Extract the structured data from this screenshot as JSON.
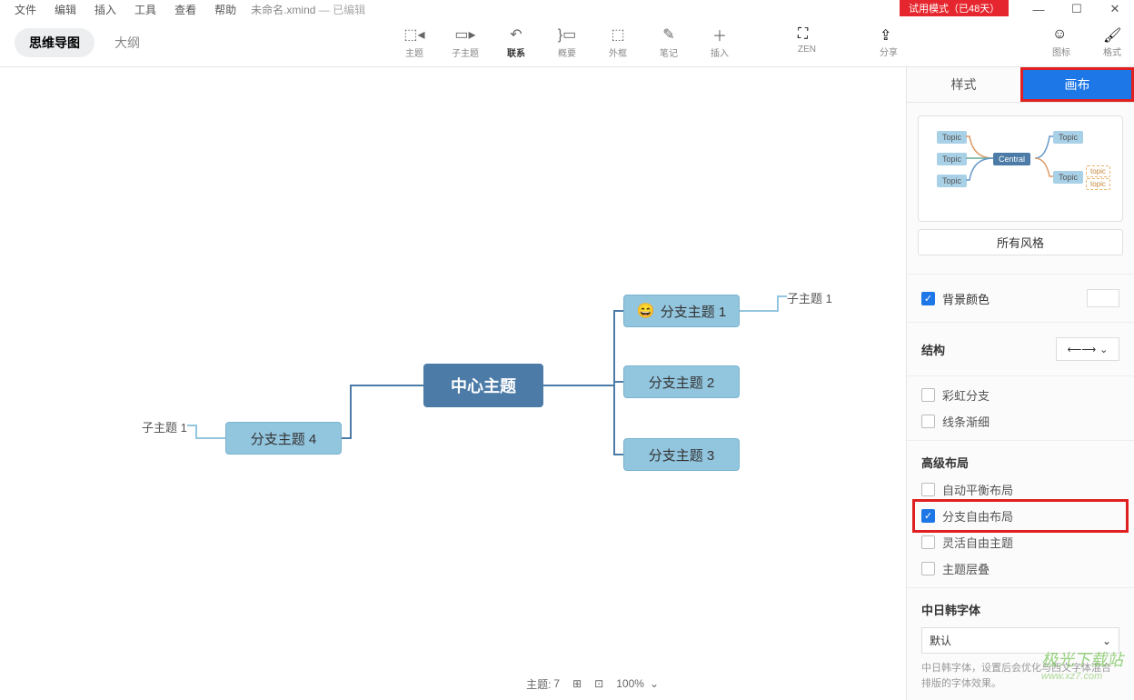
{
  "menu": {
    "file": "文件",
    "edit": "编辑",
    "insert": "插入",
    "tools": "工具",
    "view": "查看",
    "help": "帮助"
  },
  "doc": {
    "name": "未命名.xmind",
    "status": "— 已编辑"
  },
  "trial": "试用模式（已48天）",
  "viewToggle": {
    "mindmap": "思维导图",
    "outline": "大纲"
  },
  "tools": {
    "topic": "主题",
    "subtopic": "子主题",
    "relation": "联系",
    "summary": "概要",
    "boundary": "外框",
    "note": "笔记",
    "insert": "插入",
    "zen": "ZEN",
    "share": "分享",
    "icon": "图标",
    "format": "格式"
  },
  "mindmap": {
    "central": "中心主题",
    "b1": "分支主题 1",
    "b2": "分支主题 2",
    "b3": "分支主题 3",
    "b4": "分支主题 4",
    "sub1r": "子主题 1",
    "sub1l": "子主题 1"
  },
  "panel": {
    "tab_style": "样式",
    "tab_canvas": "画布",
    "all_styles": "所有风格",
    "bg_color": "背景颜色",
    "structure": "结构",
    "rainbow": "彩虹分支",
    "thinline": "线条渐细",
    "adv_layout": "高级布局",
    "auto_balance": "自动平衡布局",
    "free_branch": "分支自由布局",
    "free_topic": "灵活自由主题",
    "topic_overlap": "主题层叠",
    "cjk_font": "中日韩字体",
    "font_default": "默认",
    "font_desc": "中日韩字体，设置后会优化与西文字体混合排版的字体效果。",
    "preview_central": "Central",
    "preview_topic": "Topic",
    "preview_topic2": "topic"
  },
  "status": {
    "topic_count_label": "主题:",
    "topic_count": "7",
    "zoom": "100%"
  },
  "watermark": {
    "brand": "极光下载站",
    "url": "www.xz7.com"
  }
}
